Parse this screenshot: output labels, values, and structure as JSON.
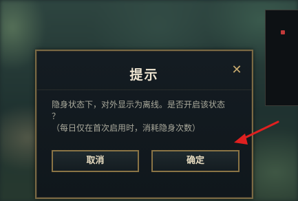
{
  "dialog": {
    "title": "提示",
    "close_symbol": "✕",
    "message_line1": "隐身状态下，对外显示为离线。是否开启该状态",
    "message_line2": "？",
    "message_line3": "（每日仅在首次启用时，消耗隐身次数）",
    "cancel_label": "取消",
    "confirm_label": "确定"
  },
  "colors": {
    "accent_gold": "#c8aa6e",
    "border_gold": "#8a7445",
    "annotation_arrow": "#e02020"
  },
  "icons": {
    "close": "close-icon",
    "annotation": "red-arrow-annotation"
  }
}
